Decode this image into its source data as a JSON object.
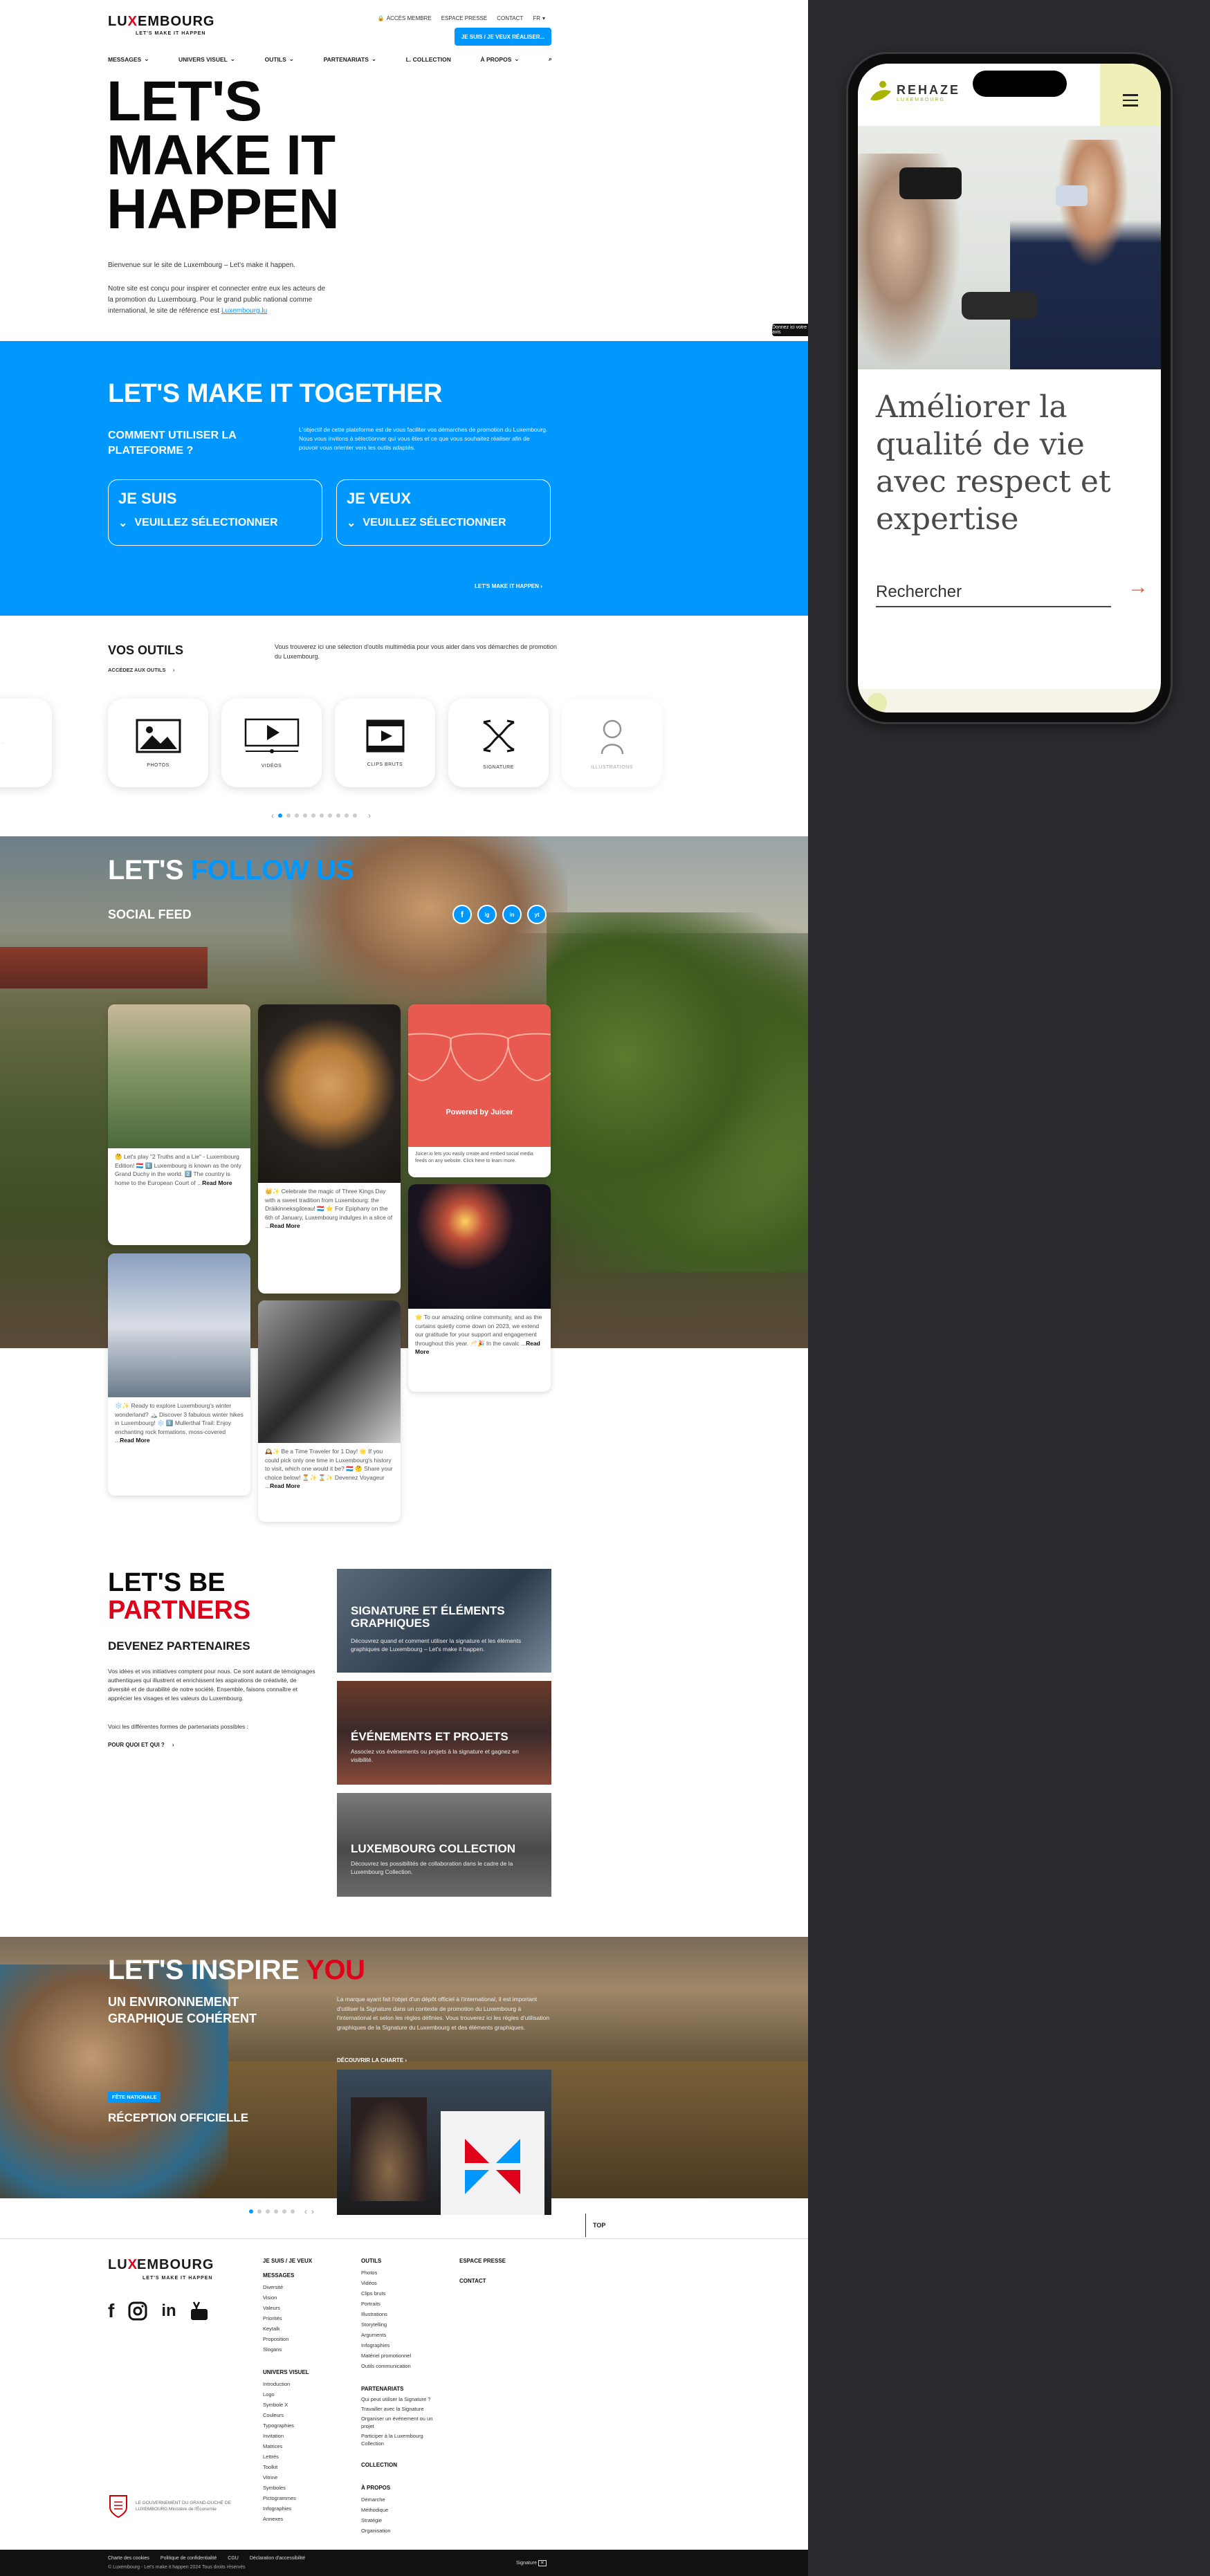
{
  "header": {
    "logo_word_a": "LU",
    "logo_x": "X",
    "logo_word_b": "EMBOURG",
    "logo_tag": "LET'S MAKE IT HAPPEN",
    "top_links": [
      "ACCÈS MEMBRE",
      "ESPACE PRESSE",
      "CONTACT",
      "FR"
    ],
    "cta": "JE SUIS / JE VEUX RÉALISER...",
    "nav": [
      "MESSAGES",
      "UNIVERS VISUEL",
      "OUTILS",
      "PARTENARIATS",
      "L. COLLECTION",
      "À PROPOS"
    ]
  },
  "hero": {
    "title_l1": "LET'S",
    "title_l2": "MAKE IT",
    "title_l3": "HAPPEN",
    "intro": "Bienvenue sur le site de Luxembourg – Let's make it happen.",
    "body": "Notre site est conçu pour inspirer et connecter entre eux les acteurs de la promotion du Luxembourg. Pour le grand public national comme international, le site de référence est",
    "body_link": "Luxembourg.lu",
    "feedback": "Donnez ici votre avis"
  },
  "together": {
    "title": "LET'S MAKE IT TOGETHER",
    "question": "COMMENT UTILISER LA PLATEFORME ?",
    "desc": "L'objectif de cette plateforme est de vous faciliter vos démarches de promotion du Luxembourg. Nous vous invitons à sélectionner qui vous êtes et ce que vous souhaitez réaliser afin de pouvoir vous orienter vers les outils adaptés.",
    "box1_title": "JE SUIS",
    "box1_select": "VEUILLEZ SÉLECTIONNER",
    "box2_title": "JE VEUX",
    "box2_select": "VEUILLEZ SÉLECTIONNER",
    "more": "LET'S MAKE IT HAPPEN"
  },
  "outils": {
    "title": "VOS OUTILS",
    "sub": "ACCÉDEZ AUX OUTILS",
    "desc": "Vous trouverez ici une sélection d'outils multimédia pour vous aider dans vos démarches de promotion du Luxembourg.",
    "tools": [
      {
        "label": "PHOTOS",
        "icon": "photo-icon"
      },
      {
        "label": "VIDÉOS",
        "icon": "video-icon"
      },
      {
        "label": "CLIPS BRUTS",
        "icon": "film-icon"
      },
      {
        "label": "SIGNATURE",
        "icon": "signature-icon"
      },
      {
        "label": "ILLUSTRATIONS",
        "icon": "illustration-icon"
      }
    ]
  },
  "follow": {
    "title_a": "LET'S",
    "title_b": "FOLLOW US",
    "social_feed": "SOCIAL FEED",
    "social": [
      "f",
      "ig",
      "in",
      "yt"
    ],
    "posts": [
      {
        "text": "🤔 Let's play \"2 Truths and a Lie\" - Luxembourg Edition! 🇱🇺 1️⃣ Luxembourg is known as the only Grand Duchy in the world. 2️⃣ The country is home to the European Court of ...",
        "more": "Read More"
      },
      {
        "text": "👑✨ Celebrate the magic of Three Kings Day with a sweet tradition from Luxembourg: the Dräikinneksgâteau! 🇱🇺 ⭐ For Epiphany on the 6th of January, Luxembourg indulges in a slice of ...",
        "more": "Read More"
      },
      {
        "text": "Powered by Juicer",
        "more": ""
      },
      {
        "text": "🌟 To our amazing online community, and as the curtains quietly come down on 2023, we extend our gratitude for your support and engagement throughout this year. 🥂🎉 In the cavalc ...",
        "more": "Read More"
      },
      {
        "text": "❄️✨ Ready to explore Luxembourg's winter wonderland? 🏔️ Discover 3 fabulous winter hikes in Luxembourg! ❄️ 1️⃣ Mullerthal Trail: Enjoy enchanting rock formations, moss-covered ...",
        "more": "Read More"
      },
      {
        "text": "🕰️✨ Be a Time Traveler for 1 Day! 🌟 If you could pick only one time in Luxembourg's history to visit, which one would it be? 🇱🇺 🤔 Share your choice below! ⏳✨ ⌛✨ Devenez Voyageur ...",
        "more": "Read More"
      }
    ],
    "juicer_note": "Juicer.io lets you easily create and embed social media feeds on any website. Click here to learn more."
  },
  "partners": {
    "title_a": "LET'S BE",
    "title_b": "PARTNERS",
    "heading": "DEVENEZ PARTENAIRES",
    "p1": "Vos idées et vos initiatives comptent pour nous. Ce sont autant de témoignages authentiques qui illustrent et enrichissent les aspirations de créativité, de diversité et de durabilité de notre société. Ensemble, faisons connaître et apprécier les visages et les valeurs du Luxembourg.",
    "p2": "Voici les différentes formes de partenariats possibles :",
    "link": "POUR QUOI ET QUI ?",
    "cards": [
      {
        "title": "SIGNATURE ET ÉLÉMENTS GRAPHIQUES",
        "desc": "Découvrez quand et comment utiliser la signature et les éléments graphiques de Luxembourg – Let's make it happen."
      },
      {
        "title": "ÉVÉNEMENTS ET PROJETS",
        "desc": "Associez vos événements ou projets à la signature et gagnez en visibilité."
      },
      {
        "title": "LUXEMBOURG COLLECTION",
        "desc": "Découvrez les possibilités de collaboration dans le cadre de la Luxembourg Collection."
      }
    ]
  },
  "inspire": {
    "title_a": "LET'S INSPIRE",
    "title_b": "YOU",
    "heading": "UN ENVIRONNEMENT GRAPHIQUE COHÉRENT",
    "desc": "La marque ayant fait l'objet d'un dépôt officiel à l'international, il est important d'utiliser la Signature dans un contexte de promotion du Luxembourg à l'international et selon les règles définies. Vous trouverez ici les règles d'utilisation graphiques de la Signature du Luxembourg et des éléments graphiques.",
    "link": "DÉCOUVRIR LA CHARTE",
    "badge": "FÊTE NATIONALE",
    "reception": "RÉCEPTION OFFICIELLE",
    "top": "TOP"
  },
  "footer": {
    "col1": {
      "h": "JE SUIS / JE VEUX",
      "h2": "MESSAGES",
      "items": [
        "Diversité",
        "Vision",
        "Valeurs",
        "Priorités",
        "Keytalk",
        "Proposition",
        "Slogans"
      ],
      "h3": "UNIVERS VISUEL",
      "items2": [
        "Introduction",
        "Logo",
        "Symbole X",
        "Couleurs",
        "Typographies",
        "Invitation",
        "Matrices",
        "Lettrés",
        "Toolkit",
        "Vitrine",
        "Symboles",
        "Pictogrammes",
        "Infographies",
        "Annexes"
      ]
    },
    "col2": {
      "h": "OUTILS",
      "items": [
        "Photos",
        "Vidéos",
        "Clips bruts",
        "Portraits",
        "Illustrations",
        "Storytelling",
        "Arguments",
        "Infographies",
        "Matériel promotionnel",
        "Outils communication"
      ],
      "h2": "PARTENARIATS",
      "items2": [
        "Qui peut utiliser la Signature ?",
        "Travailler avec la Signature",
        "Organiser un événement ou un projet",
        "Participer à la Luxembourg Collection"
      ],
      "h3": "COLLECTION",
      "h4": "À PROPOS",
      "items4": [
        "Démarche",
        "Méthodique",
        "Stratégie",
        "Organisation"
      ]
    },
    "col3": {
      "h": "ESPACE PRESSE",
      "h2": "CONTACT"
    },
    "gov": "LE GOUVERNEMENT DU GRAND-DUCHÉ DE LUXEMBOURG Ministère de l'Économie",
    "legal_links": [
      "Charte des cookies",
      "Politique de confidentialité",
      "CGU",
      "Déclaration d'accessibilité"
    ],
    "copyright": "© Luxembourg - Let's make it happen 2024 Tous droits réservés",
    "signature": "Signature"
  },
  "phone": {
    "logo": "REHAZE",
    "logo_sub": "LUXEMBOURG",
    "title": "Améliorer la qualité de vie avec respect et expertise",
    "search": "Rechercher",
    "arrow": "→"
  }
}
